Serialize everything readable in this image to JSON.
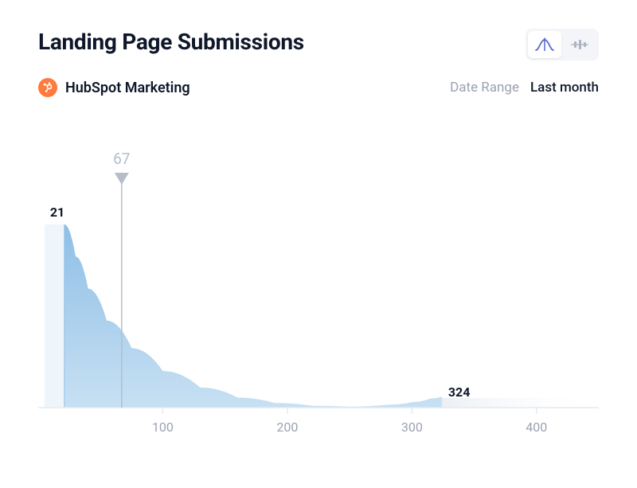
{
  "title": "Landing Page Submissions",
  "source": {
    "name": "HubSpot Marketing",
    "icon": "hubspot"
  },
  "date_range": {
    "label": "Date Range",
    "value": "Last month"
  },
  "toggle": {
    "distribution": {
      "active": true,
      "label": "distribution-view"
    },
    "timeline": {
      "active": false,
      "label": "timeline-view"
    }
  },
  "chart_data": {
    "type": "area",
    "title": "Landing Page Submissions",
    "xlabel": "",
    "ylabel": "",
    "xlim": [
      0,
      450
    ],
    "x_ticks": [
      100,
      200,
      300,
      400
    ],
    "left_value": 21,
    "right_value": 324,
    "marker_value": 67,
    "curve": [
      {
        "x": 21,
        "y": 200
      },
      {
        "x": 30,
        "y": 165
      },
      {
        "x": 40,
        "y": 130
      },
      {
        "x": 55,
        "y": 95
      },
      {
        "x": 75,
        "y": 65
      },
      {
        "x": 100,
        "y": 40
      },
      {
        "x": 130,
        "y": 22
      },
      {
        "x": 160,
        "y": 11
      },
      {
        "x": 190,
        "y": 5
      },
      {
        "x": 220,
        "y": 2
      },
      {
        "x": 250,
        "y": 1
      },
      {
        "x": 280,
        "y": 3
      },
      {
        "x": 300,
        "y": 6
      },
      {
        "x": 315,
        "y": 10
      },
      {
        "x": 324,
        "y": 12
      }
    ]
  },
  "colors": {
    "area_fill": "#8fbfe6",
    "area_fill_light": "#dff0fb",
    "baseline": "#e6e9ef",
    "marker": "#b6bdc9",
    "accent": "#5b6fcf",
    "hubspot": "#ff7a3c"
  }
}
